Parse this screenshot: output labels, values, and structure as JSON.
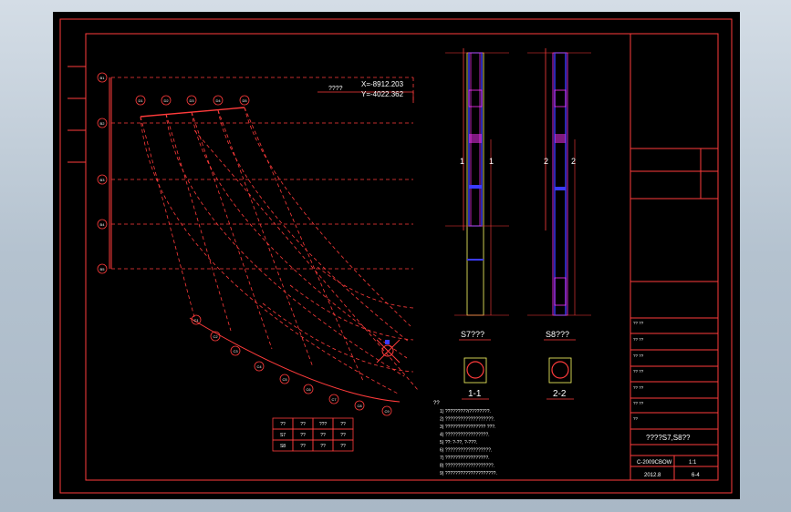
{
  "coords": {
    "label": "????",
    "x": "X=-8912.203",
    "y": "Y=-4022.362"
  },
  "sections": {
    "col1_title": "S7???",
    "col2_title": "S8???",
    "cut1": "1-1",
    "cut2": "2-2",
    "mark1": "1",
    "mark2": "2"
  },
  "notes": {
    "heading": "??",
    "lines": [
      "1) ?????????/????????.",
      "2) ???????????????????.",
      "3) ???????????????? ???.",
      "4) ?????????????????.",
      "5) ??: ?-??, ?-???.",
      "6) ??????????????????.",
      "7) ?????????????????.",
      "8) ???????????????????.",
      "9) ????????????????????."
    ]
  },
  "legend_table": {
    "rows": [
      [
        "??",
        "??",
        "???",
        "??"
      ],
      [
        "S7",
        "??",
        "??",
        "??"
      ],
      [
        "S8",
        "??",
        "??",
        "??"
      ]
    ]
  },
  "title_block": {
    "drawing_title": "????S7,S8??",
    "drawing_no": "C-2009CBOW",
    "scale": "1:1",
    "date": "2012.8",
    "sheet": "6-4",
    "rows": [
      "?? ??",
      "?? ??",
      "?? ??",
      "?? ??",
      "?? ??",
      "?? ??",
      "??",
      "??"
    ]
  },
  "grid_axes": {
    "left": [
      "B1",
      "B2",
      "B3",
      "B4",
      "B5"
    ],
    "top": [
      "D1",
      "D2",
      "D3",
      "D4",
      "D5"
    ],
    "arc": [
      "C1",
      "C2",
      "C3",
      "C4",
      "C5",
      "C6",
      "C7",
      "C8",
      "C9"
    ]
  },
  "colors": {
    "frame": "#ff3b3b",
    "column": "#3b3bff",
    "stirrup": "#ff33ff",
    "text": "#ffffff",
    "background": "#000000"
  }
}
